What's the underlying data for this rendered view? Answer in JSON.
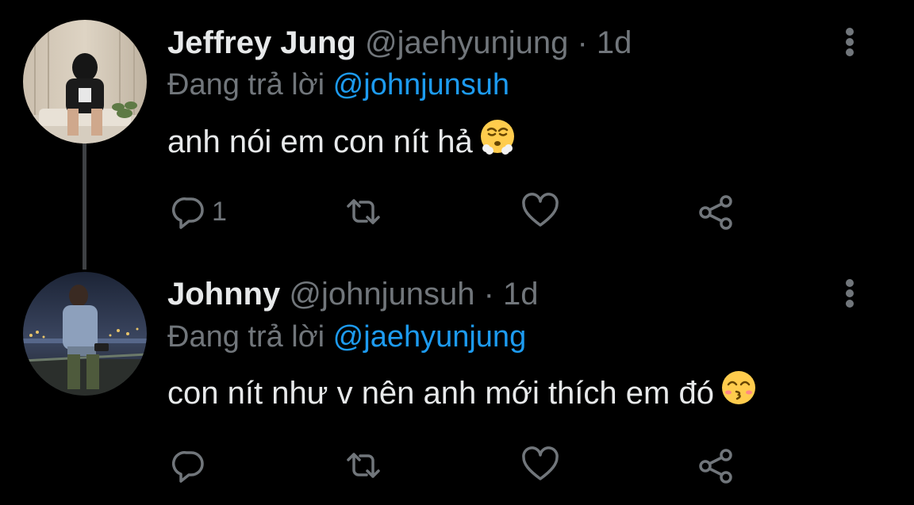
{
  "colors": {
    "background": "#000000",
    "primary_text": "#e7e9ea",
    "secondary_text": "#71767b",
    "accent": "#1d9bf0",
    "thread_line": "#3e4144"
  },
  "tweets": [
    {
      "display_name": "Jeffrey Jung",
      "handle": "@jaehyunjung",
      "separator": "·",
      "time": "1d",
      "replying_prefix": "Đang trả lời",
      "replying_to": "@johnjunsuh",
      "text": "anh nói em con nít hả",
      "emoji": "face-with-steam-from-nose",
      "reply_count": "1",
      "retweet_count": "",
      "like_count": ""
    },
    {
      "display_name": "Johnny",
      "handle": "@johnjunsuh",
      "separator": "·",
      "time": "1d",
      "replying_prefix": "Đang trả lời",
      "replying_to": "@jaehyunjung",
      "text": "con nít như v nên anh mới thích em đó",
      "emoji": "kissing-face-with-smiling-eyes",
      "reply_count": "",
      "retweet_count": "",
      "like_count": ""
    }
  ],
  "icons": {
    "reply": "reply-icon",
    "retweet": "retweet-icon",
    "like": "heart-icon",
    "share": "share-icon",
    "more": "more-options-icon"
  }
}
